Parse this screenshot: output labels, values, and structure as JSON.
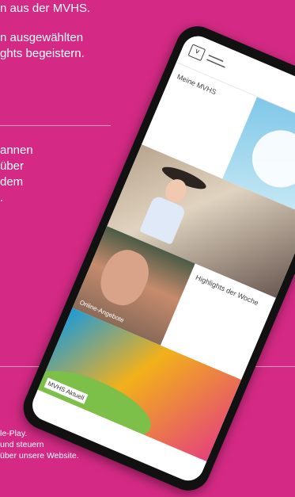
{
  "background": {
    "paragraph_1": [
      "n aus der MVHS."
    ],
    "paragraph_2": [
      "n ausgewählten",
      "ghts begeistern."
    ],
    "paragraph_3": [
      "annen",
      "über",
      "dem",
      "."
    ],
    "footer_text": [
      "le-Play.",
      "und steuern",
      "über unsere Website."
    ]
  },
  "app": {
    "menu_label": "Meine MVHS",
    "highlight_label": "Highlights der Woche",
    "online_label": "Online-Angebote",
    "aktuell_label": "MVHS Aktuell"
  },
  "colors": {
    "background": "#d42a85"
  }
}
